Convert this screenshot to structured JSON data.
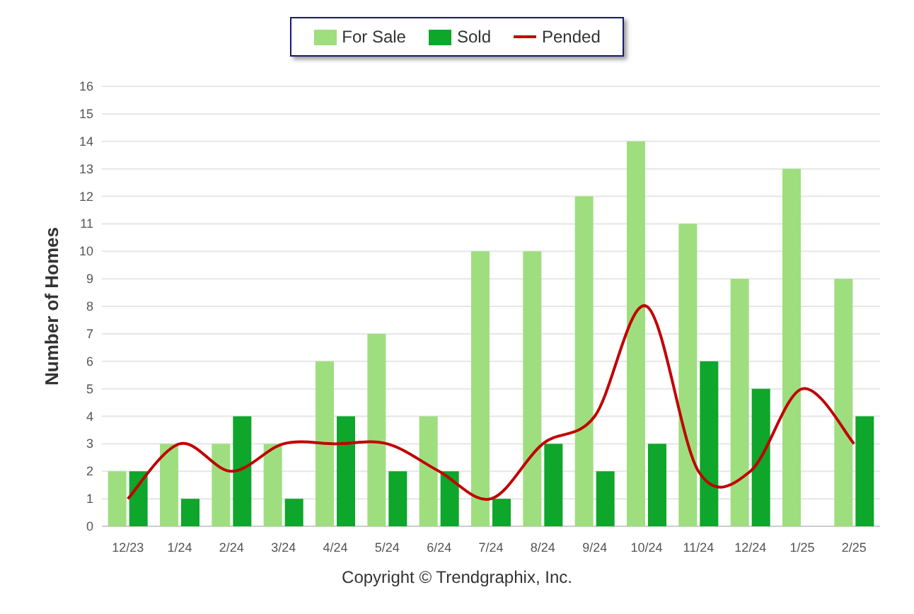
{
  "chart": {
    "chart_data": {
      "type": "bar",
      "ylabel": "Number of Homes",
      "categories": [
        "12/23",
        "1/24",
        "2/24",
        "3/24",
        "4/24",
        "5/24",
        "6/24",
        "7/24",
        "8/24",
        "9/24",
        "10/24",
        "11/24",
        "12/24",
        "1/25",
        "2/25"
      ],
      "series": [
        {
          "name": "For Sale",
          "color": "#9ede7f",
          "values": [
            2,
            3,
            3,
            3,
            6,
            7,
            4,
            10,
            10,
            12,
            14,
            11,
            9,
            13,
            9
          ]
        },
        {
          "name": "Sold",
          "color": "#0ea62b",
          "values": [
            2,
            1,
            4,
            1,
            4,
            2,
            2,
            1,
            3,
            2,
            3,
            6,
            5,
            0,
            4
          ]
        },
        {
          "name": "Pended",
          "color": "#c00000",
          "type": "line",
          "values": [
            1,
            3,
            2,
            3,
            3,
            3,
            2,
            1,
            3,
            4,
            8,
            2,
            2,
            5,
            3
          ]
        }
      ],
      "ylim": [
        0,
        16
      ],
      "grid": true,
      "yticks": [
        0,
        1,
        2,
        3,
        4,
        5,
        6,
        7,
        8,
        9,
        10,
        11,
        12,
        13,
        14,
        15,
        16
      ]
    },
    "credit": "Copyright © Trendgraphix, Inc."
  }
}
